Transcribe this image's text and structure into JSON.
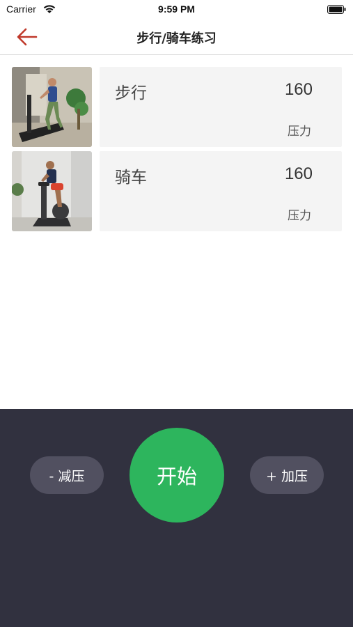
{
  "status_bar": {
    "carrier": "Carrier",
    "time": "9:59 PM",
    "icons": [
      "wifi-icon",
      "battery-icon"
    ]
  },
  "nav": {
    "title": "步行/骑车练习",
    "back_icon": "arrow-left-icon",
    "accent_color": "#c0392b"
  },
  "exercises": [
    {
      "name": "步行",
      "value": "160",
      "unit": "压力",
      "image": "treadmill-walking-photo"
    },
    {
      "name": "骑车",
      "value": "160",
      "unit": "压力",
      "image": "exercise-bike-photo"
    }
  ],
  "controls": {
    "decrease_label": "- 减压",
    "start_label": "开始",
    "increase_label": "+ 加压",
    "panel_color": "#31313f",
    "start_color": "#2db55d"
  }
}
